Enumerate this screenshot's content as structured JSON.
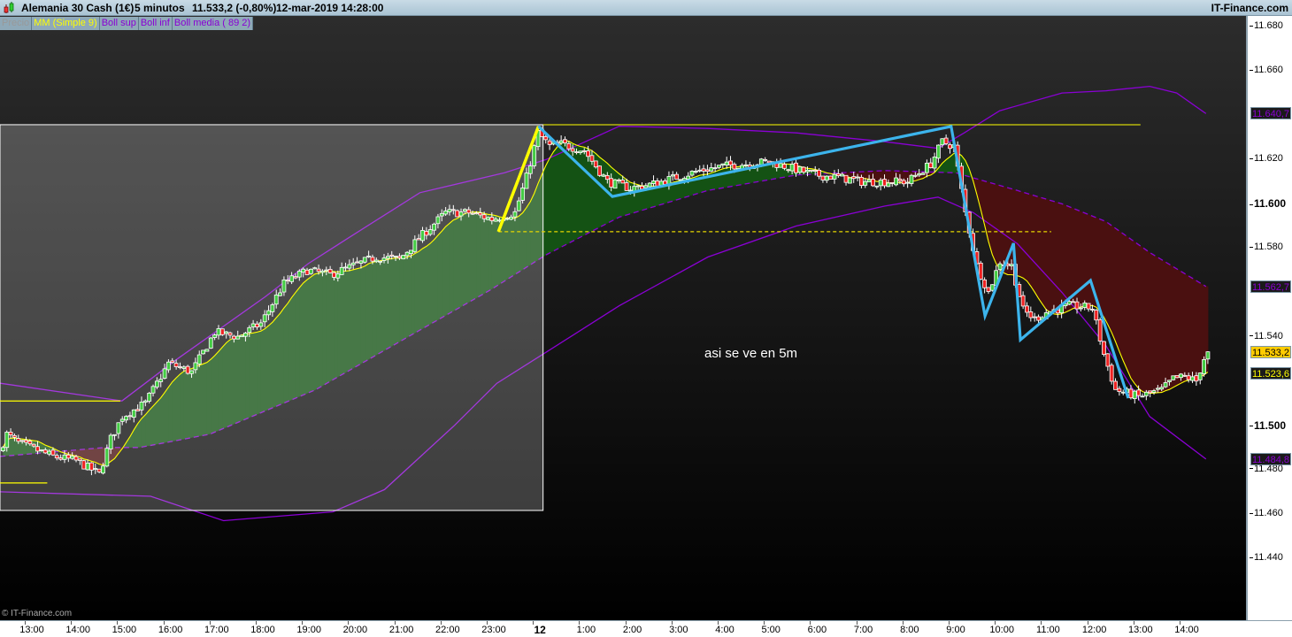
{
  "header": {
    "title": "Alemania 30 Cash (1€)",
    "timeframe": "5 minutos",
    "price": "11.533,2 (-0,80%)",
    "datetime": "12-mar-2019 14:28:00",
    "brand": "IT-Finance.com",
    "icon": "candlestick-icon"
  },
  "legend": [
    {
      "label": "Precio",
      "color": "#999999"
    },
    {
      "label": "MM (Simple 9)",
      "color": "#ffff00"
    },
    {
      "label": "Boll sup",
      "color": "#8a00d4"
    },
    {
      "label": "Boll inf",
      "color": "#8a00d4"
    },
    {
      "label": "Boll media ( 89 2)",
      "color": "#8a00d4"
    }
  ],
  "watermark": "© IT-Finance.com",
  "annotation_text": "asi se ve en 5m",
  "y_axis": {
    "ticks": [
      {
        "label": "11.680",
        "value": 11680,
        "bold": false
      },
      {
        "label": "11.660",
        "value": 11660,
        "bold": false
      },
      {
        "label": "11.620",
        "value": 11620,
        "bold": false
      },
      {
        "label": "11.600",
        "value": 11600,
        "bold": true
      },
      {
        "label": "11.580",
        "value": 11580,
        "bold": false
      },
      {
        "label": "11.540",
        "value": 11540,
        "bold": false
      },
      {
        "label": "11.500",
        "value": 11500,
        "bold": true
      },
      {
        "label": "11.480",
        "value": 11480,
        "bold": false
      },
      {
        "label": "11.460",
        "value": 11460,
        "bold": false
      },
      {
        "label": "11.440",
        "value": 11440,
        "bold": false
      }
    ],
    "value_labels": [
      {
        "label": "11.640,7",
        "value": 11640.7,
        "bg": "#1a1a1a",
        "fg": "#8a00d4",
        "series": "Boll sup"
      },
      {
        "label": "11.562,7",
        "value": 11562.7,
        "bg": "#1a1a1a",
        "fg": "#8a00d4",
        "series": "Boll media"
      },
      {
        "label": "11.533,2",
        "value": 11533.2,
        "bg": "#ffcc00",
        "fg": "#000000",
        "series": "Precio"
      },
      {
        "label": "11.523,6",
        "value": 11523.6,
        "bg": "#1a1a1a",
        "fg": "#ffff00",
        "series": "MM (Simple 9)"
      },
      {
        "label": "11.484,8",
        "value": 11484.8,
        "bg": "#1a1a1a",
        "fg": "#8a00d4",
        "series": "Boll inf"
      }
    ]
  },
  "x_axis": {
    "ticks": [
      {
        "label": "13:00",
        "time": "11 13:00",
        "bold": false
      },
      {
        "label": "14:00",
        "time": "11 14:00",
        "bold": false
      },
      {
        "label": "15:00",
        "time": "11 15:00",
        "bold": false
      },
      {
        "label": "16:00",
        "time": "11 16:00",
        "bold": false
      },
      {
        "label": "17:00",
        "time": "11 17:00",
        "bold": false
      },
      {
        "label": "18:00",
        "time": "11 18:00",
        "bold": false
      },
      {
        "label": "19:00",
        "time": "11 19:00",
        "bold": false
      },
      {
        "label": "20:00",
        "time": "11 20:00",
        "bold": false
      },
      {
        "label": "21:00",
        "time": "11 21:00",
        "bold": false
      },
      {
        "label": "22:00",
        "time": "11 22:00",
        "bold": false
      },
      {
        "label": "23:00",
        "time": "11 23:00",
        "bold": false
      },
      {
        "label": "12",
        "time": "12 00:00",
        "bold": true
      },
      {
        "label": "1:00",
        "time": "12 01:00",
        "bold": false
      },
      {
        "label": "2:00",
        "time": "12 02:00",
        "bold": false
      },
      {
        "label": "3:00",
        "time": "12 03:00",
        "bold": false
      },
      {
        "label": "4:00",
        "time": "12 04:00",
        "bold": false
      },
      {
        "label": "5:00",
        "time": "12 05:00",
        "bold": false
      },
      {
        "label": "6:00",
        "time": "12 06:00",
        "bold": false
      },
      {
        "label": "7:00",
        "time": "12 07:00",
        "bold": false
      },
      {
        "label": "8:00",
        "time": "12 08:00",
        "bold": false
      },
      {
        "label": "9:00",
        "time": "12 09:00",
        "bold": false
      },
      {
        "label": "10:00",
        "time": "12 10:00",
        "bold": false
      },
      {
        "label": "11:00",
        "time": "12 11:00",
        "bold": false
      },
      {
        "label": "12:00",
        "time": "12 12:00",
        "bold": false
      },
      {
        "label": "13:00",
        "time": "12 13:00",
        "bold": false
      },
      {
        "label": "14:00",
        "time": "12 14:00",
        "bold": false
      }
    ]
  },
  "chart_data": {
    "type": "candlestick",
    "interval_minutes": 5,
    "ylim": [
      11430,
      11685
    ],
    "grid": false,
    "colors": {
      "up": "#44cc44",
      "down": "#ee2222",
      "wick": "#ffffff",
      "mm": "#ffff00",
      "boll": "#8a00d4",
      "fill_up": "#145214",
      "fill_down": "#4a1010"
    },
    "price_path": [
      [
        "11 12:20",
        11488
      ],
      [
        "11 12:30",
        11496
      ],
      [
        "11 12:45",
        11492
      ],
      [
        "11 13:00",
        11490
      ],
      [
        "11 13:30",
        11486
      ],
      [
        "11 14:00",
        11484
      ],
      [
        "11 14:30",
        11478
      ],
      [
        "11 14:45",
        11494
      ],
      [
        "11 15:00",
        11504
      ],
      [
        "11 15:30",
        11510
      ],
      [
        "11 16:00",
        11528
      ],
      [
        "11 16:30",
        11524
      ],
      [
        "11 17:00",
        11542
      ],
      [
        "11 17:30",
        11540
      ],
      [
        "11 18:00",
        11546
      ],
      [
        "11 18:30",
        11564
      ],
      [
        "11 19:00",
        11570
      ],
      [
        "11 19:30",
        11568
      ],
      [
        "11 20:00",
        11572
      ],
      [
        "11 20:30",
        11576
      ],
      [
        "11 21:00",
        11575
      ],
      [
        "11 21:30",
        11586
      ],
      [
        "11 22:00",
        11596
      ],
      [
        "11 22:30",
        11596
      ],
      [
        "11 23:00",
        11593
      ],
      [
        "11 23:30",
        11596
      ],
      [
        "11 23:45",
        11612
      ],
      [
        "12 00:00",
        11632
      ],
      [
        "12 00:15",
        11626
      ],
      [
        "12 00:30",
        11627
      ],
      [
        "12 01:00",
        11624
      ],
      [
        "12 01:30",
        11610
      ],
      [
        "12 02:00",
        11607
      ],
      [
        "12 02:30",
        11609
      ],
      [
        "12 03:00",
        11612
      ],
      [
        "12 03:30",
        11615
      ],
      [
        "12 04:00",
        11617
      ],
      [
        "12 04:30",
        11618
      ],
      [
        "12 05:00",
        11619
      ],
      [
        "12 05:30",
        11616
      ],
      [
        "12 06:00",
        11613
      ],
      [
        "12 06:30",
        11612
      ],
      [
        "12 07:00",
        11610
      ],
      [
        "12 07:30",
        11610
      ],
      [
        "12 08:00",
        11610
      ],
      [
        "12 08:30",
        11618
      ],
      [
        "12 08:45",
        11628
      ],
      [
        "12 09:00",
        11626
      ],
      [
        "12 09:15",
        11596
      ],
      [
        "12 09:30",
        11572
      ],
      [
        "12 09:45",
        11560
      ],
      [
        "12 10:00",
        11574
      ],
      [
        "12 10:15",
        11572
      ],
      [
        "12 10:30",
        11552
      ],
      [
        "12 10:45",
        11548
      ],
      [
        "12 11:00",
        11551
      ],
      [
        "12 11:30",
        11554
      ],
      [
        "12 12:00",
        11553
      ],
      [
        "12 12:15",
        11532
      ],
      [
        "12 12:30",
        11516
      ],
      [
        "12 13:00",
        11513
      ],
      [
        "12 13:30",
        11516
      ],
      [
        "12 13:45",
        11521
      ],
      [
        "12 14:00",
        11522
      ],
      [
        "12 14:15",
        11520
      ],
      [
        "12 14:28",
        11533.2
      ]
    ],
    "series": [
      {
        "name": "Boll sup",
        "style": "solid",
        "points": [
          [
            "11 12:19",
            11519
          ],
          [
            "11 14:57",
            11511
          ],
          [
            "11 16:09",
            11530
          ],
          [
            "11 17:06",
            11544
          ],
          [
            "11 18:03",
            11558
          ],
          [
            "11 18:59",
            11573
          ],
          [
            "11 19:53",
            11585
          ],
          [
            "11 21:24",
            11605
          ],
          [
            "11 23:14",
            11614
          ],
          [
            "12 00:08",
            11620
          ],
          [
            "12 01:43",
            11635
          ],
          [
            "12 03:38",
            11634
          ],
          [
            "12 05:33",
            11632
          ],
          [
            "12 07:28",
            11628
          ],
          [
            "12 08:37",
            11625
          ],
          [
            "12 09:11",
            11632
          ],
          [
            "12 09:57",
            11642
          ],
          [
            "12 11:18",
            11650
          ],
          [
            "12 12:15",
            11651
          ],
          [
            "12 13:12",
            11653
          ],
          [
            "12 13:47",
            11650
          ],
          [
            "12 14:25",
            11640.7
          ]
        ]
      },
      {
        "name": "Boll inf",
        "style": "solid",
        "points": [
          [
            "11 12:19",
            11470
          ],
          [
            "11 15:34",
            11468
          ],
          [
            "11 17:09",
            11457
          ],
          [
            "11 19:31",
            11461
          ],
          [
            "11 20:38",
            11471
          ],
          [
            "11 22:09",
            11500
          ],
          [
            "11 23:04",
            11519
          ],
          [
            "12 00:08",
            11533
          ],
          [
            "12 01:43",
            11554
          ],
          [
            "12 03:38",
            11576
          ],
          [
            "12 05:33",
            11590
          ],
          [
            "12 07:28",
            11599
          ],
          [
            "12 08:37",
            11603
          ],
          [
            "12 09:23",
            11596
          ],
          [
            "12 10:20",
            11582
          ],
          [
            "12 11:18",
            11560
          ],
          [
            "12 12:15",
            11536
          ],
          [
            "12 13:12",
            11504
          ],
          [
            "12 14:25",
            11484.8
          ]
        ]
      },
      {
        "name": "Boll media ( 89 2)",
        "style": "dashed",
        "points": [
          [
            "11 12:19",
            11486
          ],
          [
            "11 14:35",
            11490
          ],
          [
            "11 15:20",
            11490
          ],
          [
            "11 16:51",
            11496
          ],
          [
            "11 19:08",
            11516
          ],
          [
            "11 21:24",
            11543
          ],
          [
            "11 22:55",
            11561
          ],
          [
            "12 00:08",
            11577
          ],
          [
            "12 01:43",
            11594
          ],
          [
            "12 03:38",
            11606
          ],
          [
            "12 05:33",
            11613
          ],
          [
            "12 07:28",
            11615
          ],
          [
            "12 09:00",
            11614
          ],
          [
            "12 10:20",
            11606
          ],
          [
            "12 11:18",
            11600
          ],
          [
            "12 12:15",
            11592
          ],
          [
            "12 13:12",
            11578
          ],
          [
            "12 14:25",
            11562.7
          ]
        ]
      },
      {
        "name": "MM (Simple 9)",
        "style": "solid",
        "period": 9
      }
    ],
    "drawings": {
      "range_box": {
        "from": "11 12:19",
        "to": "12 00:04",
        "top": 11635.7,
        "bottom": 11461.6
      },
      "resistance_line": {
        "from": "11 12:19",
        "to": "12 13:00",
        "price": 11635.7
      },
      "short_lines": [
        {
          "from": "11 12:19",
          "to": "11 14:55",
          "price": 11511
        },
        {
          "from": "11 12:19",
          "to": "11 13:20",
          "price": 11474
        }
      ],
      "dashed_support": {
        "from": "11 23:06",
        "to": "12 11:04",
        "price": 11587.4
      },
      "yellow_trend": [
        [
          "11 23:06",
          11587.4
        ],
        [
          "11 23:58",
          11634.9
        ]
      ],
      "blue_zigzag": [
        [
          "11 23:58",
          11634.9
        ],
        [
          "12 01:34",
          11603.3
        ],
        [
          "12 08:54",
          11634.9
        ],
        [
          "12 09:38",
          11549.4
        ],
        [
          "12 10:15",
          11582.2
        ],
        [
          "12 10:24",
          11538.6
        ],
        [
          "12 11:55",
          11565.4
        ],
        [
          "12 12:44",
          11512.3
        ]
      ]
    }
  }
}
